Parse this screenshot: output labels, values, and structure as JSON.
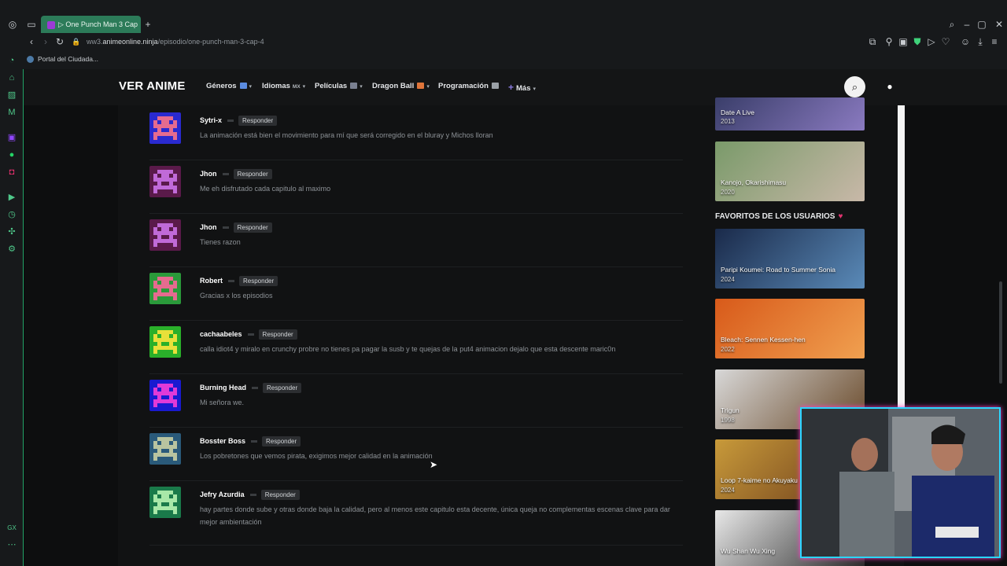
{
  "browser": {
    "tab_title": "▷ One Punch Man 3 Cap",
    "url_prefix": "ww3.",
    "url_domain": "animeonline.ninja",
    "url_path": "/episodio/one-punch-man-3-cap-4",
    "bookmark": "Portal del Ciudada...",
    "gx_label": "GX"
  },
  "site": {
    "logo": "VER ANIME",
    "nav": [
      {
        "label": "Géneros",
        "swatch": "#5a8be0"
      },
      {
        "label": "Idiomas",
        "sub": "MX"
      },
      {
        "label": "Películas",
        "swatch": "#7a8090"
      },
      {
        "label": "Dragon Ball",
        "swatch": "#e0753a"
      },
      {
        "label": "Programación",
        "swatch": "#9aa0a6"
      },
      {
        "label": "Más",
        "plus": "+"
      }
    ],
    "search_icon": "⌕",
    "user_icon": "👤"
  },
  "comments": [
    {
      "name": "Sytri-x",
      "reply": "Responder",
      "text": "La animación está bien el movimiento para mí que será corregido en el bluray y Michos lloran",
      "fg": "#e56b8f",
      "bg": "#2a2ad0"
    },
    {
      "name": "Jhon",
      "reply": "Responder",
      "text": "Me eh disfrutado cada capitulo al maximo",
      "fg": "#c06ad8",
      "bg": "#5a1a4a"
    },
    {
      "name": "Jhon",
      "reply": "Responder",
      "text": "Tienes razon",
      "fg": "#c06ad8",
      "bg": "#5a1a4a"
    },
    {
      "name": "Robert",
      "reply": "Responder",
      "text": "Gracias x los episodios",
      "fg": "#e56b8f",
      "bg": "#2a9a3a"
    },
    {
      "name": "cachaabeles",
      "reply": "Responder",
      "text": "calla idiot4 y miralo en crunchy probre no tienes pa pagar la susb y te quejas de la put4 animacion dejalo que esta descente maric0n",
      "fg": "#e8e03a",
      "bg": "#2ab02a"
    },
    {
      "name": "Burning Head",
      "reply": "Responder",
      "text": "Mi señora we.",
      "fg": "#e03ad8",
      "bg": "#1a1ad0"
    },
    {
      "name": "Bosster Boss",
      "reply": "Responder",
      "text": "Los pobretones que vemos pirata, exigimos mejor calidad en la animación",
      "fg": "#b8c4a0",
      "bg": "#2a5a7a"
    },
    {
      "name": "Jefry Azurdia",
      "reply": "Responder",
      "text": "hay partes donde sube y otras donde baja la calidad, pero al menos este capitulo esta decente, única queja no complementas escenas clave para dar mejor ambientación",
      "fg": "#a8e8a8",
      "bg": "#1a7a4a"
    }
  ],
  "sidebar": {
    "top_cards": [
      {
        "title": "Date A Live",
        "year": "2013",
        "color1": "#3a3e6a",
        "color2": "#8a7ac0"
      },
      {
        "title": "Kanojo, Okarishimasu",
        "year": "2020",
        "color1": "#7a9a6a",
        "color2": "#c8b8a8"
      }
    ],
    "favorites_title": "FAVORITOS DE LOS USUARIOS",
    "favorites": [
      {
        "title": "Paripi Koumei: Road to Summer Sonia",
        "year": "2024",
        "color1": "#1a2a4a",
        "color2": "#5a8ab8"
      },
      {
        "title": "Bleach: Sennen Kessen-hen",
        "year": "2022",
        "color1": "#d85a1a",
        "color2": "#f0a050"
      },
      {
        "title": "Trigun",
        "year": "1998",
        "color1": "#d8d8d8",
        "color2": "#6a4a2a"
      },
      {
        "title": "Loop 7-kaime no Akuyaku",
        "year": "2024",
        "color1": "#c89a3a",
        "color2": "#6a3a1a"
      },
      {
        "title": "Wu Shan Wu Xing",
        "year": "",
        "color1": "#e8e8e8",
        "color2": "#2a2a2a"
      }
    ]
  }
}
